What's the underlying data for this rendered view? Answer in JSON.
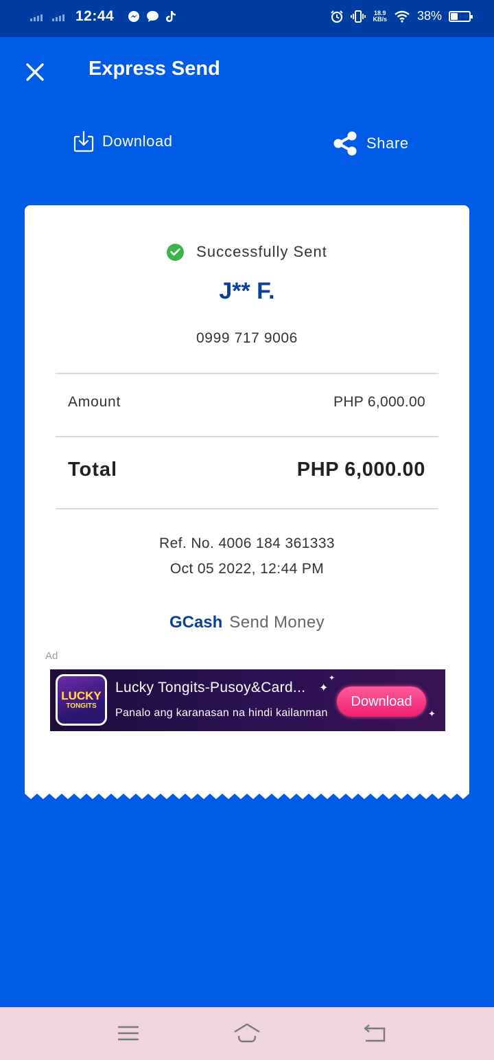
{
  "status_bar": {
    "time": "12:44",
    "net_speed_value": "18.9",
    "net_speed_unit": "KB/s",
    "battery_percent": "38%",
    "battery_level": 0.38
  },
  "header": {
    "title": "Express Send",
    "download_label": "Download",
    "share_label": "Share"
  },
  "receipt": {
    "status": "Successfully Sent",
    "recipient_name": "J** F.",
    "recipient_number": "0999 717 9006",
    "amount_label": "Amount",
    "amount_value": "PHP 6,000.00",
    "total_label": "Total",
    "total_value": "PHP 6,000.00",
    "reference": "Ref. No. 4006 184 361333",
    "datetime": "Oct 05 2022, 12:44 PM",
    "brand_name": "GCash",
    "brand_service": "Send Money"
  },
  "ad": {
    "label": "Ad",
    "icon_text_line1": "LUCKY",
    "icon_text_line2": "TONGITS",
    "title": "Lucky Tongits-Pusoy&Card...",
    "subtitle": "Panalo ang karanasan na hindi kailanman",
    "cta": "Download"
  },
  "colors": {
    "status_bar_bg": "#003da3",
    "app_bg": "#005ce6",
    "brand_blue": "#0a3f9c",
    "success_green": "#3fb549",
    "cta_pink": "#ef1f6f"
  }
}
